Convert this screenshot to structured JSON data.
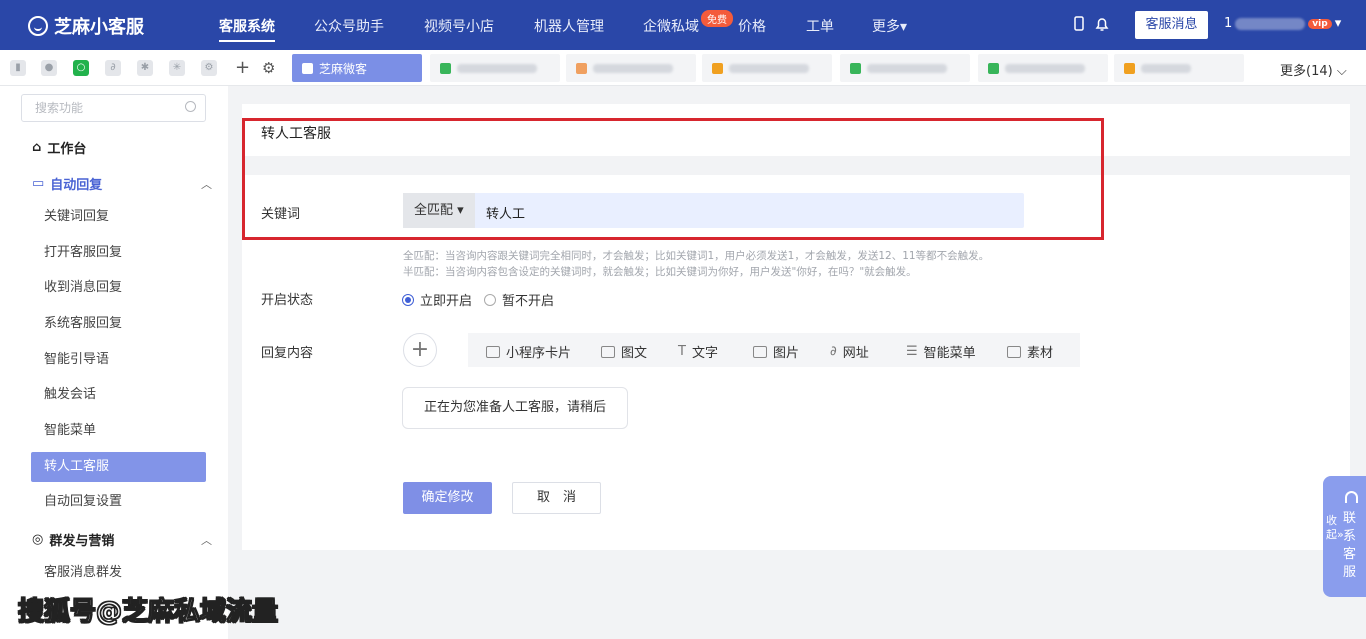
{
  "app": {
    "logo": "芝麻小客服"
  },
  "nav": {
    "items": [
      "客服系统",
      "公众号助手",
      "视频号小店",
      "机器人管理",
      "企微私域",
      "价格",
      "工单",
      "更多▾"
    ],
    "free_badge": "免费",
    "message_button": "客服消息",
    "account_prefix": "1",
    "vip_badge": "vip"
  },
  "tabs": {
    "active": "芝麻微客",
    "more": "更多(14) ⌵"
  },
  "sidebar": {
    "search_placeholder": "搜索功能",
    "workbench": "工作台",
    "auto_reply": "自动回复",
    "items": [
      "关键词回复",
      "打开客服回复",
      "收到消息回复",
      "系统客服回复",
      "智能引导语",
      "触发会话",
      "智能菜单",
      "转人工客服",
      "自动回复设置"
    ],
    "group_marketing": "群发与营销",
    "marketing_items": [
      "客服消息群发"
    ]
  },
  "form": {
    "title": "转人工客服",
    "keyword_label": "关键词",
    "match_mode": "全匹配 ▾",
    "keyword_value": "转人工",
    "hint_full": "全匹配：当咨询内容跟关键词完全相同时，才会触发；比如关键词1，用户必须发送1，才会触发，发送12、11等都不会触发。",
    "hint_half": "半匹配：当咨询内容包含设定的关键词时，就会触发；比如关键词为你好，用户发送\"你好，在吗？\"就会触发。",
    "status_label": "开启状态",
    "status_on": "立即开启",
    "status_off": "暂不开启",
    "reply_label": "回复内容",
    "reply_types": [
      "小程序卡片",
      "图文",
      "文字",
      "图片",
      "网址",
      "智能菜单",
      "素材"
    ],
    "reply_text": "正在为您准备人工客服，请稍后",
    "confirm": "确定修改",
    "cancel": "取　消"
  },
  "float_help": {
    "collapse": "收起»",
    "contact": "联系客服"
  },
  "watermark": "搜狐号@芝麻私域流量"
}
